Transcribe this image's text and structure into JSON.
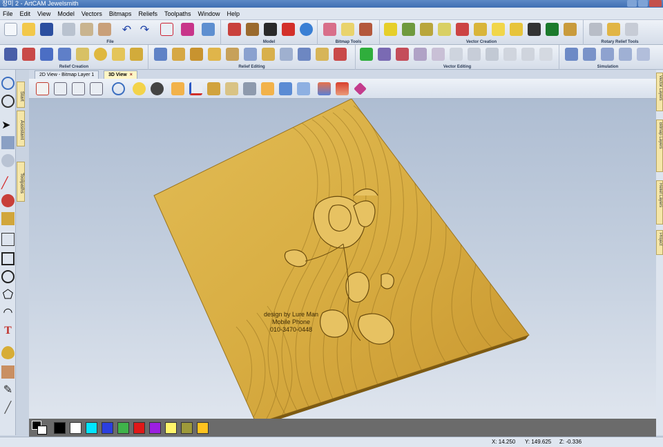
{
  "window": {
    "title": "장미 2 - ArtCAM Jewelsmith"
  },
  "menu": [
    "File",
    "Edit",
    "View",
    "Model",
    "Vectors",
    "Bitmaps",
    "Reliefs",
    "Toolpaths",
    "Window",
    "Help"
  ],
  "toolbar_groups_row1": [
    "File",
    "Model",
    "Bitmap Tools",
    "Vector Creation",
    "Rotary Relief Tools"
  ],
  "toolbar_groups_row2": [
    "Relief Creation",
    "Relief Editing",
    "Vector Editing",
    "Simulation"
  ],
  "tabs": [
    {
      "label": "2D View - Bitmap Layer 1",
      "active": false
    },
    {
      "label": "3D View",
      "active": true
    }
  ],
  "left_tabs": [
    "Start",
    "Assistant",
    "Toolpaths"
  ],
  "right_tabs": [
    "Vector Layers",
    "Bitmap Layers",
    "Relief Layers",
    "Project"
  ],
  "watermark": {
    "line1": "design by Lure Man",
    "line2": "Mobile Phone",
    "line3": "010-3470-0448"
  },
  "palette": [
    "#000000",
    "#ffffff",
    "#00e5ff",
    "#2b3fe0",
    "#3fb34a",
    "#e01818",
    "#9b1fe0",
    "#fff46a",
    "#9e9a3a",
    "#ffc31f"
  ],
  "status": {
    "x": "X: 14.250",
    "y": "Y: 149.625",
    "z": "Z: -0.336"
  },
  "colors": {
    "relief_gold": "#d9b045",
    "viewport_top": "#aebdd2",
    "active_tab": "#fff6c6"
  }
}
